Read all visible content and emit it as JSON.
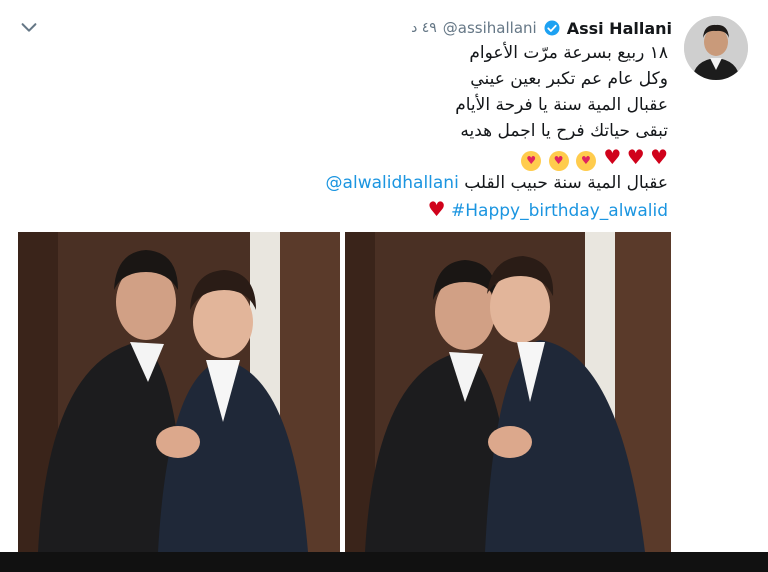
{
  "tweet": {
    "display_name": "Assi Hallani",
    "handle": "@assihallani",
    "time": "٤٩ د",
    "lines": [
      "١٨ ربيع بسرعة مرّت الأعوام",
      "وكل عام عم تكبر بعين عيني",
      "عقبال المية سنة يا فرحة الأيام",
      "تبقى حياتك فرح يا اجمل هديه"
    ],
    "mention_line_text": "عقبال المية سنة حبيب القلب",
    "mention": "@alwalidhallani",
    "hashtag": "#Happy_birthday_alwalid"
  },
  "icons": {
    "verified": "verified-badge-icon",
    "chevron": "chevron-down-icon",
    "heart": "red-heart-emoji",
    "kiss": "face-blowing-kiss-emoji"
  },
  "colors": {
    "link": "#1b95e0",
    "verified": "#1da1f2",
    "heart": "#d0021b",
    "muted": "#657786"
  }
}
